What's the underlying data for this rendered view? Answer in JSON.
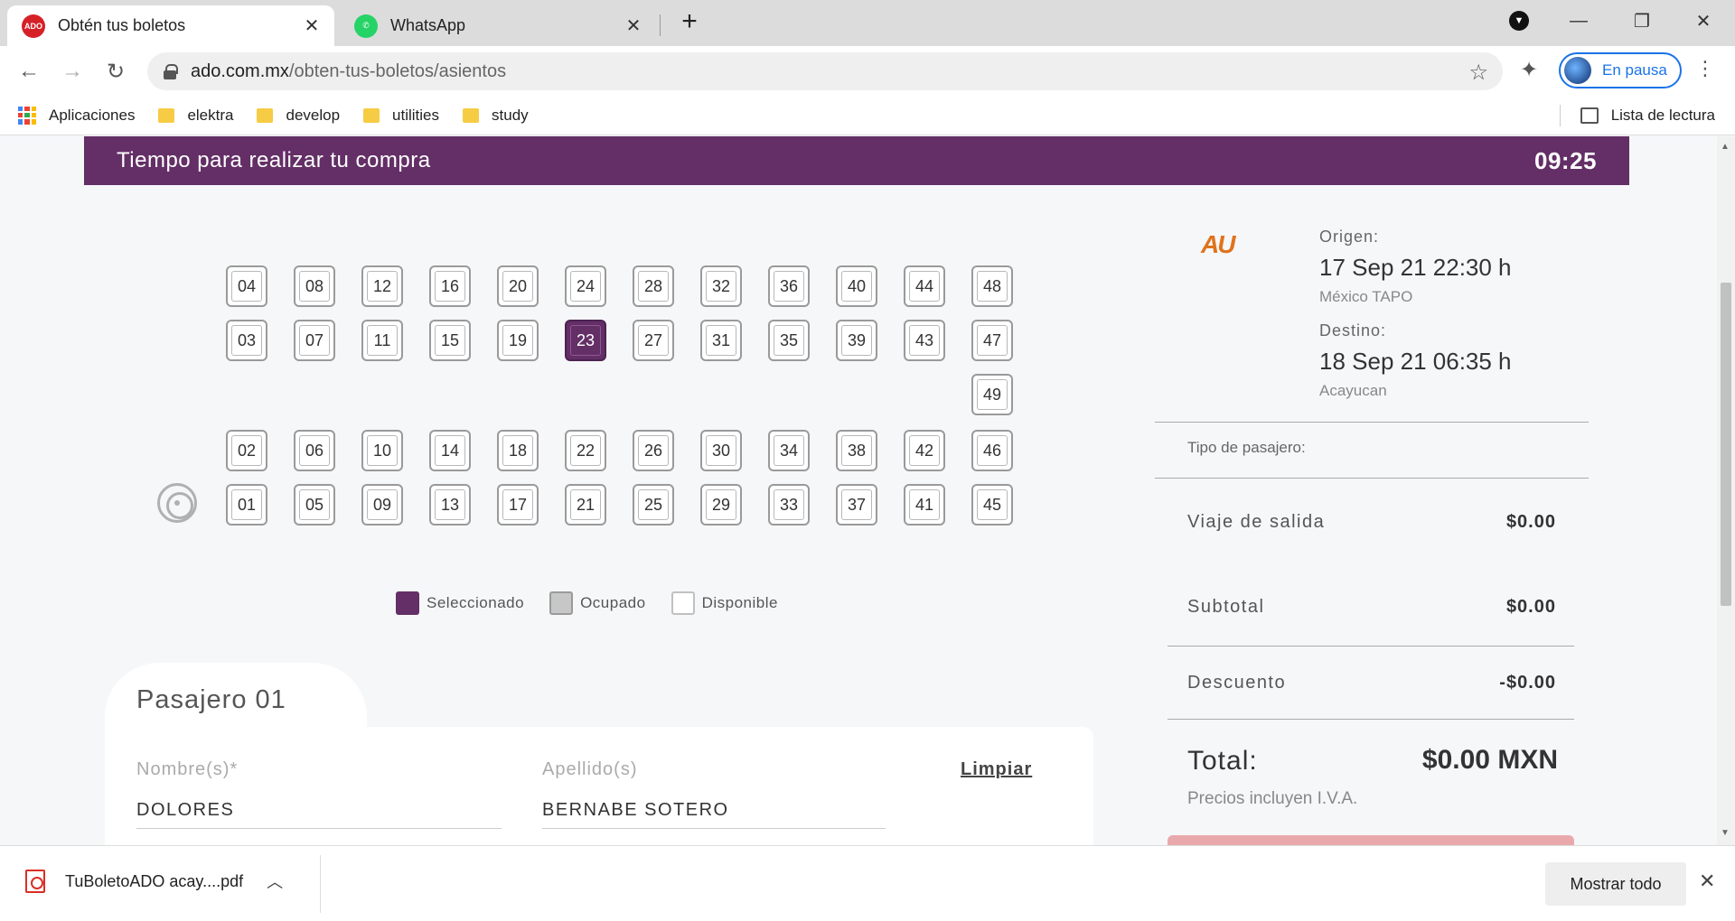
{
  "browser": {
    "tabs": [
      {
        "title": "Obtén tus boletos",
        "favicon": "ADO",
        "active": true
      },
      {
        "title": "WhatsApp",
        "favicon": "whatsapp-icon",
        "active": false
      }
    ],
    "url_host": "ado.com.mx",
    "url_path": "/obten-tus-boletos/asientos",
    "profile_label": "En pausa",
    "bookmarks": [
      "Aplicaciones",
      "elektra",
      "develop",
      "utilities",
      "study"
    ],
    "reading_list": "Lista de lectura"
  },
  "page": {
    "timer_label": "Tiempo para realizar tu compra",
    "timer_value": "09:25",
    "seats": [
      {
        "num": "04",
        "col": 0,
        "row": 0
      },
      {
        "num": "08",
        "col": 1,
        "row": 0
      },
      {
        "num": "12",
        "col": 2,
        "row": 0
      },
      {
        "num": "16",
        "col": 3,
        "row": 0
      },
      {
        "num": "20",
        "col": 4,
        "row": 0
      },
      {
        "num": "24",
        "col": 5,
        "row": 0
      },
      {
        "num": "28",
        "col": 6,
        "row": 0
      },
      {
        "num": "32",
        "col": 7,
        "row": 0
      },
      {
        "num": "36",
        "col": 8,
        "row": 0
      },
      {
        "num": "40",
        "col": 9,
        "row": 0
      },
      {
        "num": "44",
        "col": 10,
        "row": 0
      },
      {
        "num": "48",
        "col": 11,
        "row": 0
      },
      {
        "num": "03",
        "col": 0,
        "row": 1
      },
      {
        "num": "07",
        "col": 1,
        "row": 1
      },
      {
        "num": "11",
        "col": 2,
        "row": 1
      },
      {
        "num": "15",
        "col": 3,
        "row": 1
      },
      {
        "num": "19",
        "col": 4,
        "row": 1
      },
      {
        "num": "23",
        "col": 5,
        "row": 1,
        "selected": true
      },
      {
        "num": "27",
        "col": 6,
        "row": 1
      },
      {
        "num": "31",
        "col": 7,
        "row": 1
      },
      {
        "num": "35",
        "col": 8,
        "row": 1
      },
      {
        "num": "39",
        "col": 9,
        "row": 1
      },
      {
        "num": "43",
        "col": 10,
        "row": 1
      },
      {
        "num": "47",
        "col": 11,
        "row": 1
      },
      {
        "num": "49",
        "col": 11,
        "row": 2
      },
      {
        "num": "02",
        "col": 0,
        "row": 3
      },
      {
        "num": "06",
        "col": 1,
        "row": 3
      },
      {
        "num": "10",
        "col": 2,
        "row": 3
      },
      {
        "num": "14",
        "col": 3,
        "row": 3
      },
      {
        "num": "18",
        "col": 4,
        "row": 3
      },
      {
        "num": "22",
        "col": 5,
        "row": 3
      },
      {
        "num": "26",
        "col": 6,
        "row": 3
      },
      {
        "num": "30",
        "col": 7,
        "row": 3
      },
      {
        "num": "34",
        "col": 8,
        "row": 3
      },
      {
        "num": "38",
        "col": 9,
        "row": 3
      },
      {
        "num": "42",
        "col": 10,
        "row": 3
      },
      {
        "num": "46",
        "col": 11,
        "row": 3
      },
      {
        "num": "01",
        "col": 0,
        "row": 4
      },
      {
        "num": "05",
        "col": 1,
        "row": 4
      },
      {
        "num": "09",
        "col": 2,
        "row": 4
      },
      {
        "num": "13",
        "col": 3,
        "row": 4
      },
      {
        "num": "17",
        "col": 4,
        "row": 4
      },
      {
        "num": "21",
        "col": 5,
        "row": 4
      },
      {
        "num": "25",
        "col": 6,
        "row": 4
      },
      {
        "num": "29",
        "col": 7,
        "row": 4
      },
      {
        "num": "33",
        "col": 8,
        "row": 4
      },
      {
        "num": "37",
        "col": 9,
        "row": 4
      },
      {
        "num": "41",
        "col": 10,
        "row": 4
      },
      {
        "num": "45",
        "col": 11,
        "row": 4
      }
    ],
    "legend": {
      "selected": "Seleccionado",
      "occupied": "Ocupado",
      "available": "Disponible"
    },
    "passenger": {
      "title": "Pasajero 01",
      "name_label": "Nombre(s)*",
      "name_value": "DOLORES",
      "surname_label": "Apellido(s)",
      "surname_value": "BERNABE SOTERO",
      "clear_label": "Limpiar"
    },
    "summary": {
      "carrier_logo": "AU",
      "origin_label": "Origen:",
      "origin_datetime": "17 Sep 21 22:30 h",
      "origin_place": "México TAPO",
      "dest_label": "Destino:",
      "dest_datetime": "18 Sep 21 06:35 h",
      "dest_place": "Acayucan",
      "passenger_type_label": "Tipo de pasajero:",
      "outbound_label": "Viaje de salida",
      "outbound_value": "$0.00",
      "subtotal_label": "Subtotal",
      "subtotal_value": "$0.00",
      "discount_label": "Descuento",
      "discount_value": "-$0.00",
      "total_label": "Total:",
      "total_value": "$0.00 MXN",
      "tax_note": "Precios incluyen I.V.A."
    }
  },
  "downloads": {
    "file": "TuBoletoADO acay....pdf",
    "show_all": "Mostrar todo"
  },
  "colors": {
    "brand_purple": "#632f66",
    "carrier_orange": "#e0731c",
    "pay_button": "#e9a9ac"
  }
}
